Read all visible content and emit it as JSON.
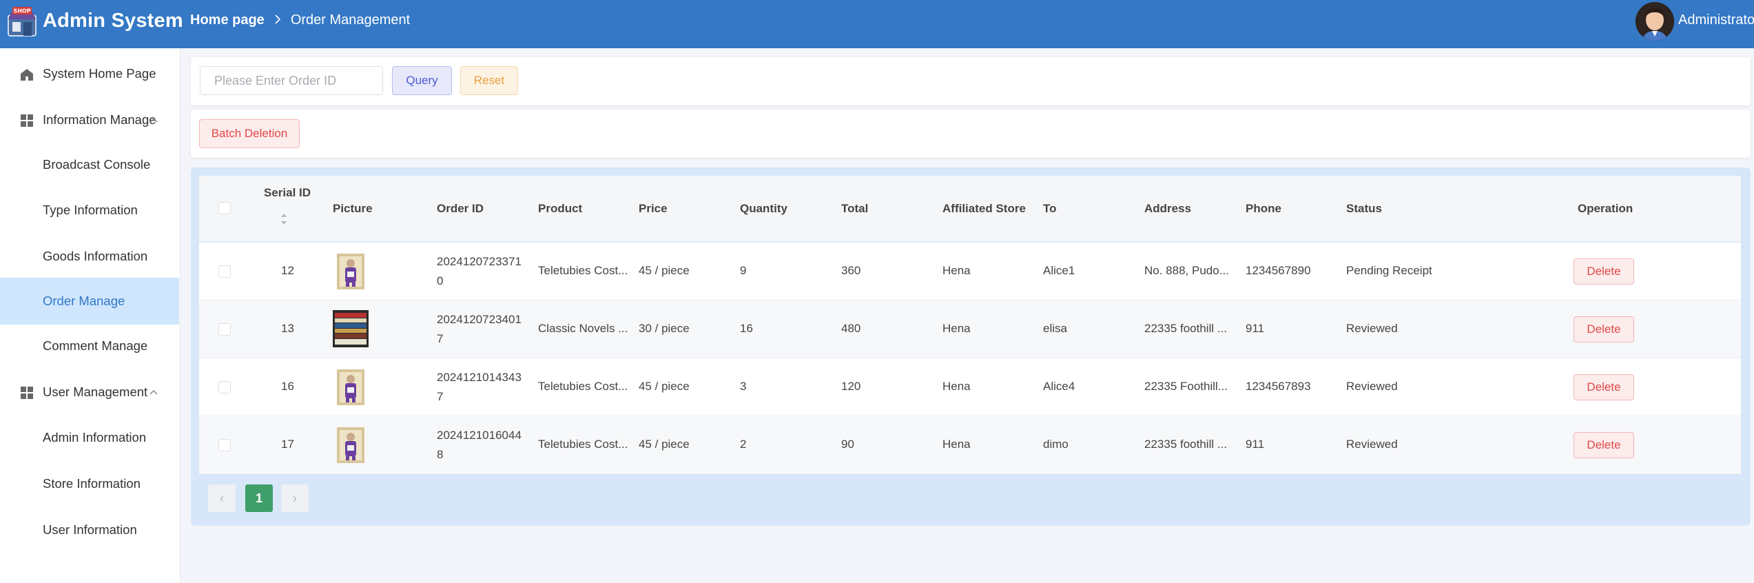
{
  "header": {
    "logo_badge": "SHOP",
    "app_title": "Admin System",
    "breadcrumb": {
      "home": "Home page",
      "separator": ">",
      "current": "Order Management"
    },
    "user_name": "Administrator"
  },
  "sidebar": {
    "items": [
      {
        "label": "System Home Page",
        "icon": "home-icon"
      },
      {
        "label": "Information Manage",
        "icon": "grid-icon"
      },
      {
        "label": "Broadcast Console"
      },
      {
        "label": "Type Information"
      },
      {
        "label": "Goods Information"
      },
      {
        "label": "Order Manage",
        "active": true
      },
      {
        "label": "Comment Manage"
      },
      {
        "label": "User Management",
        "icon": "grid-icon"
      },
      {
        "label": "Admin Information"
      },
      {
        "label": "Store Information"
      },
      {
        "label": "User Information"
      }
    ]
  },
  "search": {
    "placeholder": "Please Enter Order ID",
    "query_label": "Query",
    "reset_label": "Reset"
  },
  "toolbar": {
    "batch_delete_label": "Batch Deletion"
  },
  "table": {
    "columns": [
      "Serial ID",
      "Picture",
      "Order ID",
      "Product",
      "Price",
      "Quantity",
      "Total",
      "Affiliated Store",
      "To",
      "Address",
      "Phone",
      "Status",
      "Operation"
    ],
    "rows": [
      {
        "serial": "12",
        "order_id": "20241207233710",
        "product": "Teletubies Cost...",
        "price": "45 / piece",
        "quantity": "9",
        "total": "360",
        "store": "Hena",
        "to": "Alice1",
        "address": "No. 888, Pudo...",
        "phone": "1234567890",
        "status": "Pending Receipt",
        "action": "Delete"
      },
      {
        "serial": "13",
        "order_id": "20241207234017",
        "product": "Classic Novels ...",
        "price": "30 / piece",
        "quantity": "16",
        "total": "480",
        "store": "Hena",
        "to": "elisa",
        "address": "22335 foothill ...",
        "phone": "911",
        "status": "Reviewed",
        "action": "Delete"
      },
      {
        "serial": "16",
        "order_id": "20241210143437",
        "product": "Teletubies Cost...",
        "price": "45 / piece",
        "quantity": "3",
        "total": "120",
        "store": "Hena",
        "to": "Alice4",
        "address": "22335 Foothill...",
        "phone": "1234567893",
        "status": "Reviewed",
        "action": "Delete"
      },
      {
        "serial": "17",
        "order_id": "20241210160448",
        "product": "Teletubies Cost...",
        "price": "45 / piece",
        "quantity": "2",
        "total": "90",
        "store": "Hena",
        "to": "dimo",
        "address": "22335 foothill ...",
        "phone": "911",
        "status": "Reviewed",
        "action": "Delete"
      }
    ]
  },
  "pagination": {
    "prev": "‹",
    "current": "1",
    "next": "›"
  },
  "colors": {
    "header": "#3478c6",
    "active_menu_bg": "#cfe6fd",
    "page_active": "#3f9f6a",
    "danger": "#e04848"
  }
}
